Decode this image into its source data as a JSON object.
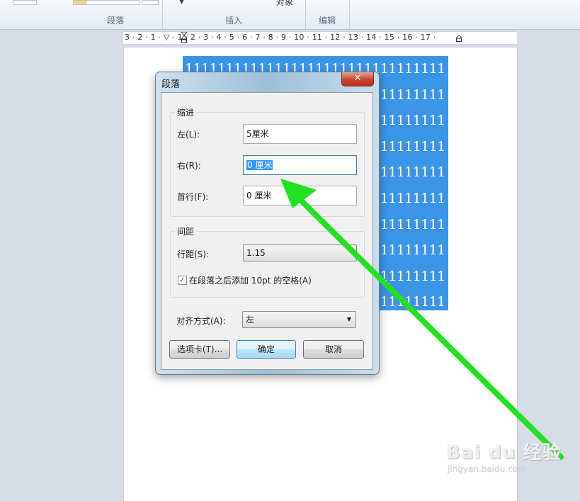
{
  "ribbon": {
    "group_paragraph": "段落",
    "group_insert": "插入",
    "group_edit": "编辑",
    "object_label": "对象"
  },
  "ruler": {
    "text": "3 · 2 · 1 · ▽ · 1 · 2 · 3 · 4 · 5 · 6 · 7 · 8 · 9 · 10 · 11 · 12 · 13 · 14 · 15 · 16 · 17 ·"
  },
  "document": {
    "selected_text": "11111111111111111111111111111111\n11111111111111111111111111111111\n11111111111111111111111111111111\n11111111111111111111111111111111\n11111111111111111111111111111111\n11111111111111111111111111111111\n11111111111111111111111111111111\n11111111111111111111111111111111\n11111111111111111111111111111111\n11111111111111111111111111111111"
  },
  "dialog": {
    "title": "段落",
    "close_glyph": "✕",
    "indent": {
      "legend": "缩进",
      "left_label": "左(L):",
      "left_value": "5厘米",
      "right_label": "右(R):",
      "right_value": "0 厘米",
      "first_label": "首行(F):",
      "first_value": "0 厘米"
    },
    "spacing": {
      "legend": "间距",
      "line_label": "行距(S):",
      "line_value": "1.15",
      "checkbox_label": "在段落之后添加 10pt 的空格(A)",
      "checkbox_checked": true
    },
    "align_label": "对齐方式(A):",
    "align_value": "左",
    "tabs_button": "选项卡(T)...",
    "ok_button": "确定",
    "cancel_button": "取消"
  },
  "annotation": {
    "arrow_color": "#22e022"
  },
  "watermark": {
    "brand": "Bai du 经验",
    "url": "jingyan.baidu.com"
  }
}
